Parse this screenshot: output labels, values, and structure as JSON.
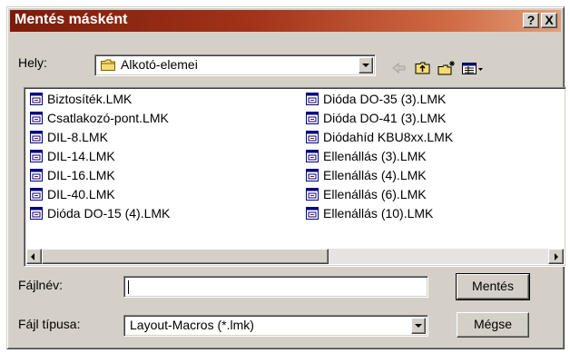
{
  "window": {
    "title": "Mentés másként",
    "help_label": "?",
    "close_label": "X"
  },
  "location": {
    "label": "Hely:",
    "value": "Alkotó-elemei",
    "icon": "folder-icon"
  },
  "toolbar": {
    "icons": [
      "back-arrow-icon",
      "up-one-level-icon",
      "new-folder-icon",
      "view-menu-icon"
    ]
  },
  "files": {
    "column1": [
      "Biztosíték.LMK",
      "Csatlakozó-pont.LMK",
      "DIL-8.LMK",
      "DIL-14.LMK",
      "DIL-16.LMK",
      "DIL-40.LMK",
      "Dióda DO-15 (4).LMK"
    ],
    "column2": [
      "Dióda DO-35 (3).LMK",
      "Dióda DO-41 (3).LMK",
      "Diódahíd KBU8xx.LMK",
      "Ellenállás (3).LMK",
      "Ellenállás (4).LMK",
      "Ellenállás (6).LMK",
      "Ellenállás (10).LMK"
    ]
  },
  "filename": {
    "label": "Fájlnév:",
    "value": ""
  },
  "filetype": {
    "label": "Fájl típusa:",
    "value": "Layout-Macros (*.lmk)"
  },
  "buttons": {
    "save": "Mentés",
    "cancel": "Mégse"
  },
  "colors": {
    "title_gradient_start": "#7b1c0b",
    "title_gradient_end": "#e2a07a",
    "face": "#d4d0c8"
  }
}
